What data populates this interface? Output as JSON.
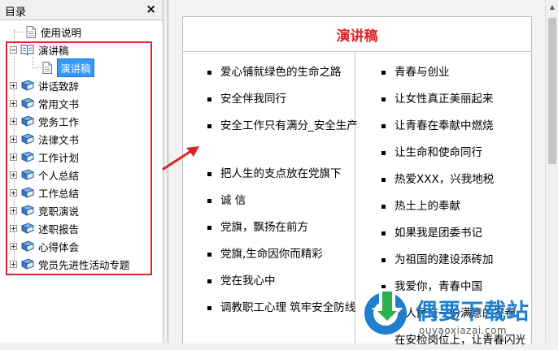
{
  "sidebar": {
    "title": "目录",
    "close_glyph": "×",
    "items": [
      {
        "label": "使用说明",
        "icon": "document-icon"
      },
      {
        "label": "演讲稿",
        "icon": "open-book-icon",
        "expanded": true,
        "children": [
          {
            "label": "演讲稿",
            "icon": "document-icon",
            "selected": true
          }
        ]
      },
      {
        "label": "讲话致辞",
        "icon": "book-icon"
      },
      {
        "label": "常用文书",
        "icon": "book-icon"
      },
      {
        "label": "党务工作",
        "icon": "book-icon"
      },
      {
        "label": "法律文书",
        "icon": "book-icon"
      },
      {
        "label": "工作计划",
        "icon": "book-icon"
      },
      {
        "label": "个人总结",
        "icon": "book-icon"
      },
      {
        "label": "工作总结",
        "icon": "book-icon"
      },
      {
        "label": "竞职演说",
        "icon": "book-icon"
      },
      {
        "label": "述职报告",
        "icon": "book-icon"
      },
      {
        "label": "心得体会",
        "icon": "book-icon"
      },
      {
        "label": "党员先进性活动专题",
        "icon": "book-icon"
      }
    ]
  },
  "document": {
    "title": "演讲稿",
    "left_column": [
      "爱心铺就绿色的生命之路",
      "安全伴我同行",
      "安全工作只有满分_安全生产",
      "把人生的支点放在党旗下",
      "诚 信",
      "党旗，飘扬在前方",
      "党旗,生命因你而精彩",
      "党在我心中",
      "调教职工心理 筑牢安全防线"
    ],
    "right_column": [
      "青春与创业",
      "让女性真正美丽起来",
      "让青春在奉献中燃烧",
      "让生命和使命同行",
      "热爱XXX，兴我地税",
      "热土上的奉献",
      "如果我是团委书记",
      "为祖国的建设添砖加",
      "我爱你，青春中国",
      "向人民交一份满意的答卷",
      "在安检岗位上，让青春闪光"
    ]
  },
  "watermark": {
    "brand_cn": "偶要下载站",
    "domain": "ouyaoxiazai.com"
  },
  "colors": {
    "title_red": "#e02020",
    "highlight_box": "#e0242e",
    "selection_blue": "#3399ff",
    "book_blue": "#3a78c8"
  }
}
